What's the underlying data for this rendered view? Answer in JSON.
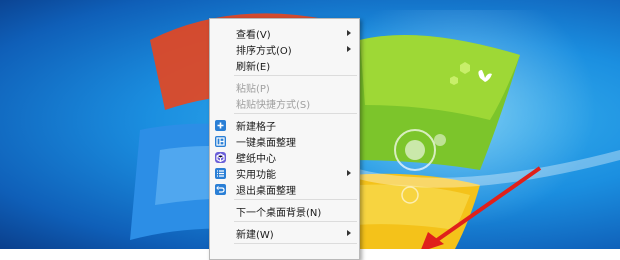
{
  "context_menu": {
    "items": [
      {
        "label": "查看(V)",
        "submenu": true
      },
      {
        "label": "排序方式(O)",
        "submenu": true
      },
      {
        "label": "刷新(E)"
      },
      {
        "label": "粘贴(P)",
        "disabled": true
      },
      {
        "label": "粘贴快捷方式(S)",
        "disabled": true
      },
      {
        "label": "新建格子",
        "icon": "plus-icon"
      },
      {
        "label": "一键桌面整理",
        "icon": "layout-icon"
      },
      {
        "label": "壁纸中心",
        "icon": "cube-icon"
      },
      {
        "label": "实用功能",
        "icon": "list-icon",
        "submenu": true
      },
      {
        "label": "退出桌面整理",
        "icon": "exit-icon"
      },
      {
        "label": "下一个桌面背景(N)"
      },
      {
        "label": "新建(W)",
        "submenu": true
      }
    ]
  },
  "colors": {
    "desktop_blue": "#1b8fe0",
    "menu_bg": "#f7f7f7",
    "icon_blue": "#2a7fd6",
    "arrow_red": "#e0201b"
  }
}
